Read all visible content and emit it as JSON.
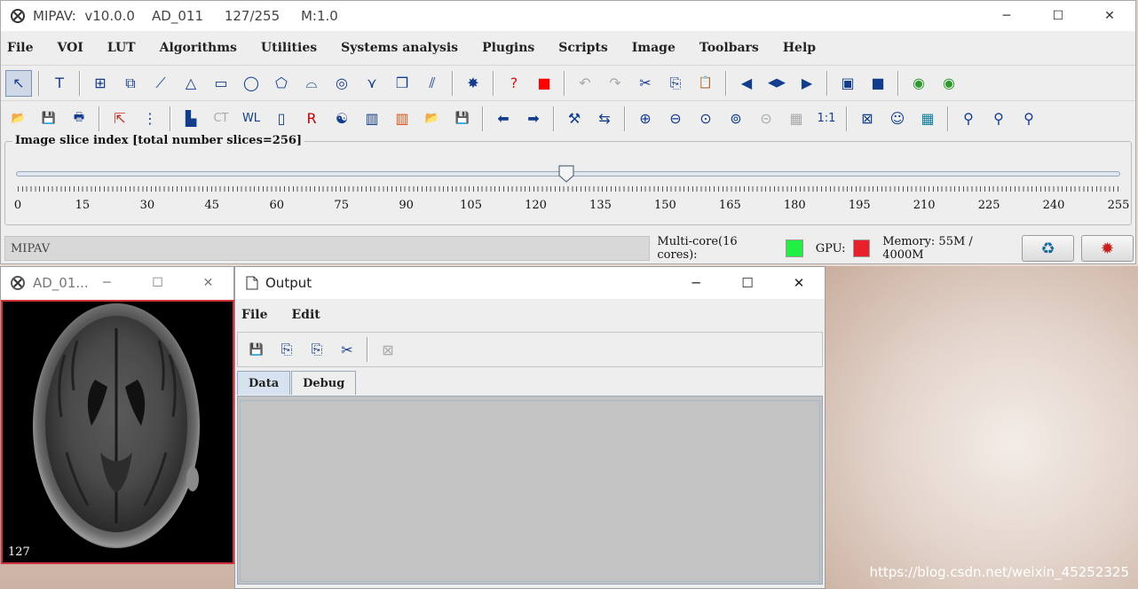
{
  "main_window": {
    "title": "MIPAV:  v10.0.0    AD_011     127/255     M:1.0",
    "controls": {
      "minimize": "─",
      "maximize": "☐",
      "close": "✕"
    },
    "menu": [
      "File",
      "VOI",
      "LUT",
      "Algorithms",
      "Utilities",
      "Systems analysis",
      "Plugins",
      "Scripts",
      "Image",
      "Toolbars",
      "Help"
    ],
    "toolbar1": [
      {
        "icon": "pointer-icon",
        "glyph": "↖",
        "selected": true
      },
      {
        "sep": true
      },
      {
        "icon": "text-icon",
        "glyph": "T"
      },
      {
        "sep": true
      },
      {
        "icon": "point-voi-icon",
        "glyph": "⊞"
      },
      {
        "icon": "multi-point-icon",
        "glyph": "⧉"
      },
      {
        "icon": "line-icon",
        "glyph": "⟋"
      },
      {
        "icon": "polyline-icon",
        "glyph": "△"
      },
      {
        "icon": "rectangle-icon",
        "glyph": "▭"
      },
      {
        "icon": "ellipse-icon",
        "glyph": "◯"
      },
      {
        "icon": "polygon-icon",
        "glyph": "⬠"
      },
      {
        "icon": "levelset-icon",
        "glyph": "⌓"
      },
      {
        "icon": "concentric-icon",
        "glyph": "◎"
      },
      {
        "icon": "livewire-icon",
        "glyph": "⋎"
      },
      {
        "icon": "cube-icon",
        "glyph": "❒"
      },
      {
        "icon": "split-icon",
        "glyph": "⫽"
      },
      {
        "sep": true
      },
      {
        "icon": "new-voi-icon",
        "glyph": "✸"
      },
      {
        "sep": true
      },
      {
        "icon": "help-icon",
        "glyph": "?",
        "color": "#e01010"
      },
      {
        "icon": "color-icon",
        "glyph": "■",
        "color": "#ff0000"
      },
      {
        "sep": true
      },
      {
        "icon": "undo-icon",
        "glyph": "↶",
        "color": "#aaaaaa"
      },
      {
        "icon": "redo-icon",
        "glyph": "↷",
        "color": "#aaaaaa"
      },
      {
        "icon": "cut-icon",
        "glyph": "✂"
      },
      {
        "icon": "copy-icon",
        "glyph": "⎘"
      },
      {
        "icon": "paste-icon",
        "glyph": "📋"
      },
      {
        "sep": true
      },
      {
        "icon": "voi-front-icon",
        "glyph": "◀"
      },
      {
        "icon": "voi-flip-icon",
        "glyph": "◀▶"
      },
      {
        "icon": "voi-back-icon",
        "glyph": "▶"
      },
      {
        "sep": true
      },
      {
        "icon": "paint-bg-icon",
        "glyph": "▣"
      },
      {
        "icon": "paint-fg-icon",
        "glyph": "■"
      },
      {
        "sep": true
      },
      {
        "icon": "propagate-up-icon",
        "glyph": "◉",
        "color": "#2c9a2c"
      },
      {
        "icon": "propagate-down-icon",
        "glyph": "◉",
        "color": "#2c9a2c"
      }
    ],
    "toolbar2": [
      {
        "icon": "open-icon",
        "glyph": "📂"
      },
      {
        "icon": "save-icon",
        "glyph": "💾"
      },
      {
        "icon": "print-icon",
        "glyph": "🖶"
      },
      {
        "sep": true
      },
      {
        "icon": "reset-icon",
        "glyph": "⇱",
        "color": "#c03020"
      },
      {
        "icon": "quick-lut-icon",
        "glyph": "⋮"
      },
      {
        "sep": true
      },
      {
        "icon": "histogram-icon",
        "glyph": "▙"
      },
      {
        "icon": "ct-icon",
        "glyph": "CT",
        "color": "#aaaaaa"
      },
      {
        "icon": "window-level-icon",
        "glyph": "WL"
      },
      {
        "icon": "threshold-icon",
        "glyph": "▯"
      },
      {
        "icon": "rgb-icon",
        "glyph": "R",
        "color": "#c00000"
      },
      {
        "icon": "yin-yang-icon",
        "glyph": "☯"
      },
      {
        "icon": "grayscale-icon",
        "glyph": "▥"
      },
      {
        "icon": "hot-lut-icon",
        "glyph": "▥",
        "color": "#e05010"
      },
      {
        "icon": "load-lut-icon",
        "glyph": "📂"
      },
      {
        "icon": "save-lut-icon",
        "glyph": "💾"
      },
      {
        "sep": true
      },
      {
        "icon": "previous-slice-icon",
        "glyph": "⬅"
      },
      {
        "icon": "next-slice-icon",
        "glyph": "➡"
      },
      {
        "sep": true
      },
      {
        "icon": "transform-icon",
        "glyph": "⚒"
      },
      {
        "icon": "swap-icon",
        "glyph": "⇆"
      },
      {
        "sep": true
      },
      {
        "icon": "zoom-in-icon",
        "glyph": "⊕"
      },
      {
        "icon": "zoom-out-icon",
        "glyph": "⊖"
      },
      {
        "icon": "zoom-fit-icon",
        "glyph": "⊙"
      },
      {
        "icon": "zoom-region-icon",
        "glyph": "⊚"
      },
      {
        "icon": "magnifier-icon",
        "glyph": "⊝",
        "color": "#aaaaaa"
      },
      {
        "icon": "checker-icon",
        "glyph": "▦",
        "color": "#aaaaaa"
      },
      {
        "icon": "one-to-one-icon",
        "glyph": "1:1"
      },
      {
        "sep": true
      },
      {
        "icon": "matrix-icon",
        "glyph": "⊠"
      },
      {
        "icon": "head-icon",
        "glyph": "☺"
      },
      {
        "icon": "grid-icon",
        "glyph": "▦",
        "color": "#1080a0"
      },
      {
        "sep": true
      },
      {
        "icon": "microscope-icon",
        "glyph": "⚲"
      },
      {
        "icon": "microscope-2-icon",
        "glyph": "⚲"
      },
      {
        "icon": "microscope-3-icon",
        "glyph": "⚲"
      }
    ],
    "slice_panel": {
      "title": "Image slice index  [total number slices=256]",
      "current": 127,
      "max": 255,
      "tick_labels": [
        "0",
        "15",
        "30",
        "45",
        "60",
        "75",
        "90",
        "105",
        "120",
        "135",
        "150",
        "165",
        "180",
        "195",
        "210",
        "225",
        "240",
        "255"
      ]
    },
    "status": {
      "message": "MIPAV",
      "multicore_label": "Multi-core(16 cores):",
      "multicore_color": "#22ee44",
      "gpu_label": "GPU:",
      "gpu_color": "#e8202c",
      "memory": "Memory: 55M / 4000M",
      "gc_icon": "recycle-icon",
      "gc_glyph": "♻",
      "debug_icon": "bug-icon",
      "debug_glyph": "✹"
    }
  },
  "image_window": {
    "title": "AD_01...",
    "controls": {
      "minimize": "─",
      "maximize": "☐",
      "close": "✕"
    },
    "slice_label": "127"
  },
  "output_window": {
    "title": "Output",
    "controls": {
      "minimize": "─",
      "maximize": "☐",
      "close": "✕"
    },
    "menu": [
      "File",
      "Edit"
    ],
    "toolbar": [
      {
        "icon": "save-icon",
        "glyph": "💾"
      },
      {
        "icon": "copy-all-icon",
        "glyph": "⎘"
      },
      {
        "icon": "copy-icon",
        "glyph": "⎘"
      },
      {
        "icon": "cut-icon",
        "glyph": "✂"
      },
      {
        "sep": true
      },
      {
        "icon": "clear-icon",
        "glyph": "⊠",
        "color": "#aaaaaa"
      }
    ],
    "tabs": [
      {
        "label": "Data",
        "active": true
      },
      {
        "label": "Debug",
        "active": false
      }
    ]
  },
  "watermark": "https://blog.csdn.net/weixin_45252325"
}
